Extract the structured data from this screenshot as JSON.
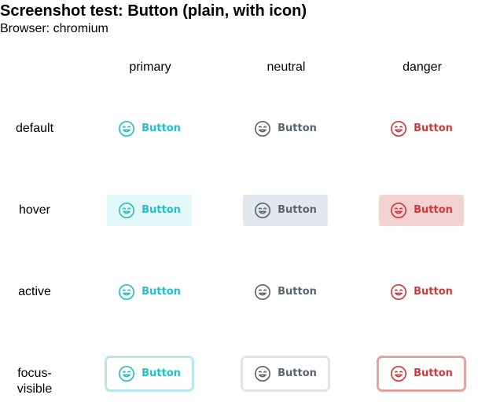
{
  "title": "Screenshot test: Button (plain, with icon)",
  "browser": "Browser: chromium",
  "columns": [
    "primary",
    "neutral",
    "danger"
  ],
  "rows": [
    "default",
    "hover",
    "active",
    "focus-visible"
  ],
  "button": {
    "label": "Button",
    "icon": "smiley-icon"
  },
  "colors": {
    "primary": "#22c1c8",
    "neutral": "#5c6670",
    "danger": "#d03a3a",
    "hover_primary": "#e4f8f9",
    "hover_neutral": "#e2e8ee",
    "hover_danger": "#f3d2d2",
    "focus_primary": "#b4e8ec",
    "focus_neutral": "#dfe5eb",
    "focus_danger": "#e5a3a0"
  }
}
